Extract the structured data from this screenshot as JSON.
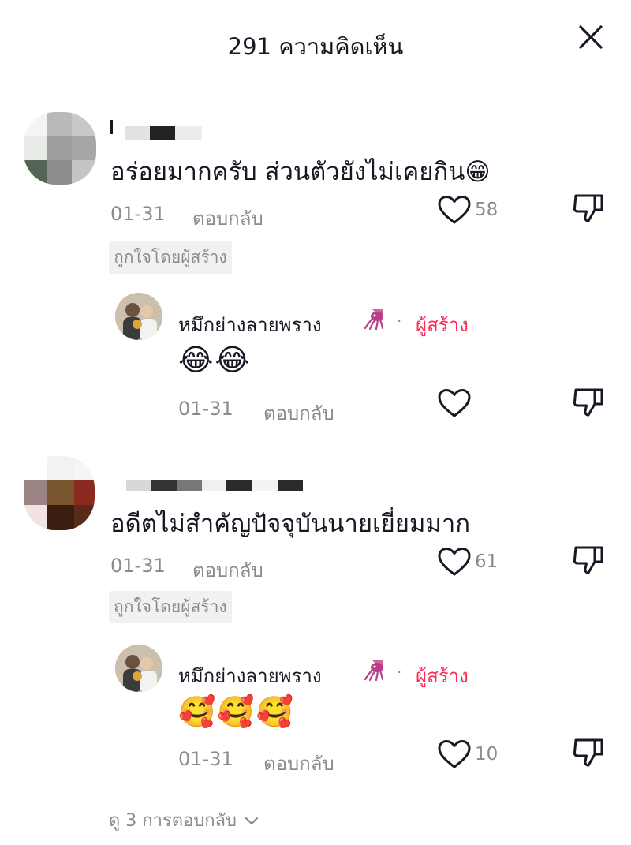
{
  "header": {
    "title": "291 ความคิดเห็น"
  },
  "comments": [
    {
      "text": "อร่อยมากครับ ส่วนตัวยังไม่เคยกิน😁",
      "date": "01-31",
      "reply_label": "ตอบกลับ",
      "likes": "58",
      "badge": "ถูกใจโดยผู้สร้าง",
      "reply": {
        "username": "หมึกย่างลายพราง",
        "separator": "·",
        "creator_label": "ผู้สร้าง",
        "text": "😂😂",
        "date": "01-31",
        "reply_label": "ตอบกลับ",
        "likes": ""
      }
    },
    {
      "text": "อดีตไม่สำคัญปัจจุบันนายเยี่ยมมาก",
      "date": "01-31",
      "reply_label": "ตอบกลับ",
      "likes": "61",
      "badge": "ถูกใจโดยผู้สร้าง",
      "reply": {
        "username": "หมึกย่างลายพราง",
        "separator": "·",
        "creator_label": "ผู้สร้าง",
        "text": "🥰🥰🥰",
        "date": "01-31",
        "reply_label": "ตอบกลับ",
        "likes": "10"
      }
    }
  ],
  "view_more_replies": "ดู 3 การตอบกลับ",
  "icons": {
    "close": "close-icon",
    "like": "heart-outline-icon",
    "dislike": "thumbs-down-icon",
    "creator": "squid-icon",
    "expand": "chevron-down-icon"
  },
  "colors": {
    "text_primary": "#161823",
    "text_secondary": "#8a8b91",
    "creator_accent": "#fe2c55",
    "badge_bg": "#f1f1f2"
  }
}
